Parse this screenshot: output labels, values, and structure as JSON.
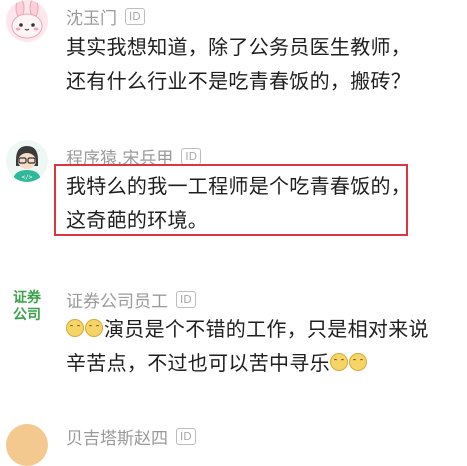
{
  "comments": [
    {
      "avatar_icon": "pink-bunny-avatar-icon",
      "username": "沈玉门",
      "badge": "ID",
      "lines": [
        "其实我想知道，除了公务员医生教师，",
        "还有什么行业不是吃青春饭的，搬砖？"
      ]
    },
    {
      "avatar_icon": "programmer-avatar-icon",
      "username": "程序猿.宋兵甲",
      "badge": "ID",
      "lines": [
        "我特么的我一工程师是个吃青春饭的，",
        "这奇葩的环境。"
      ]
    },
    {
      "avatar_icon": "securities-company-avatar-icon",
      "avatar_text": "证券\n公司",
      "username": "证券公司员工",
      "badge": "ID",
      "line1": "演员是个不错的工作，只是相对来说",
      "line2": "辛苦点，不过也可以苦中寻乐",
      "emoji_icon": "laughing-emoji-icon"
    },
    {
      "username": "贝吉塔斯赵四",
      "badge": "ID"
    }
  ],
  "colors": {
    "highlight": "#d9363e",
    "username": "#9a9a9a",
    "securities_green": "#3aa14a"
  }
}
